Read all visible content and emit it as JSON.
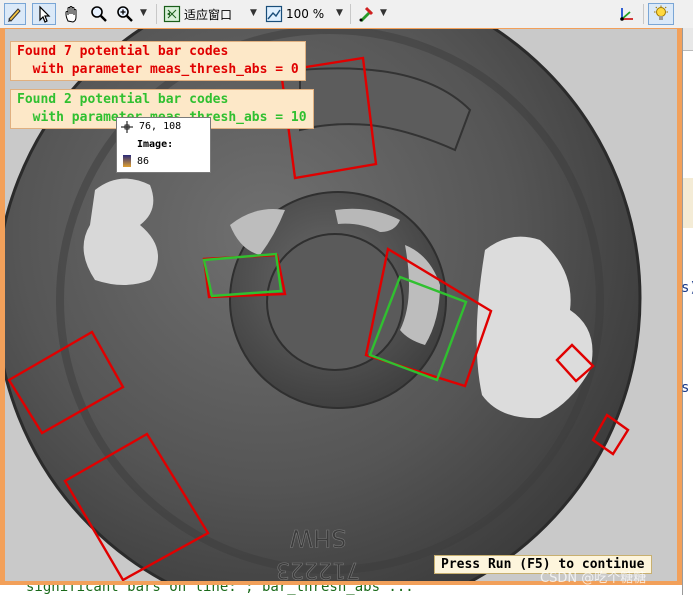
{
  "toolbar": {
    "zoom_mode_label": "适应窗口",
    "zoom_percent_label": "100 %"
  },
  "messages": {
    "red_line1": "Found 7 potential bar codes",
    "red_line2": "with parameter meas_thresh_abs = 0",
    "green_line1": "Found 2 potential bar codes",
    "green_line2": "with parameter meas_thresh_abs = 10",
    "red_color": "#e00000",
    "green_color": "#30c030"
  },
  "pixel_info": {
    "coords": "76, 108",
    "image_label": "Image:",
    "gray_value": "86"
  },
  "part_text": {
    "engraving_1": "SHW",
    "engraving_2": "712223"
  },
  "status": {
    "continue_prompt": "Press Run (F5) to continue"
  },
  "watermark": "CSDN @吃个糖糖",
  "side_panel": {
    "char_1": "s)",
    "char_2": "s"
  },
  "bottom_code_fragment": "significant bars on line: ; bar_thresh_abs ..."
}
